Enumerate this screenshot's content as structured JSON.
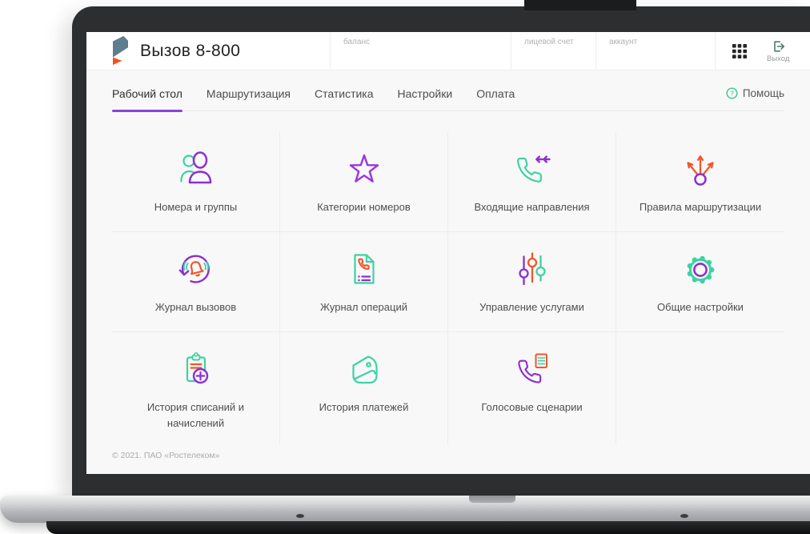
{
  "app": {
    "title": "Вызов 8-800"
  },
  "header": {
    "balance_label": "баланс",
    "account_number_label": "лицевой счет",
    "account_label": "аккаунт",
    "logout_label": "Выход"
  },
  "nav": {
    "tabs": [
      {
        "label": "Рабочий стол",
        "active": true
      },
      {
        "label": "Маршрутизация",
        "active": false
      },
      {
        "label": "Статистика",
        "active": false
      },
      {
        "label": "Настройки",
        "active": false
      },
      {
        "label": "Оплата",
        "active": false
      }
    ],
    "help_label": "Помощь"
  },
  "tiles": [
    {
      "label": "Номера и группы",
      "icon": "users-icon"
    },
    {
      "label": "Категории номеров",
      "icon": "star-icon"
    },
    {
      "label": "Входящие направления",
      "icon": "incoming-call-icon"
    },
    {
      "label": "Правила маршрутизации",
      "icon": "routing-arrows-icon"
    },
    {
      "label": "Журнал вызовов",
      "icon": "call-log-icon"
    },
    {
      "label": "Журнал операций",
      "icon": "operations-log-icon"
    },
    {
      "label": "Управление услугами",
      "icon": "sliders-icon"
    },
    {
      "label": "Общие настройки",
      "icon": "gear-icon"
    },
    {
      "label": "История списаний и начислений",
      "icon": "charges-history-icon"
    },
    {
      "label": "История платежей",
      "icon": "wallet-icon"
    },
    {
      "label": "Голосовые сценарии",
      "icon": "voice-script-icon"
    }
  ],
  "footer": {
    "copyright": "© 2021. ПАО «Ростелеком»"
  },
  "colors": {
    "purple": "#8e2fd1",
    "green": "#3bd3a3",
    "orange": "#f4562a"
  }
}
